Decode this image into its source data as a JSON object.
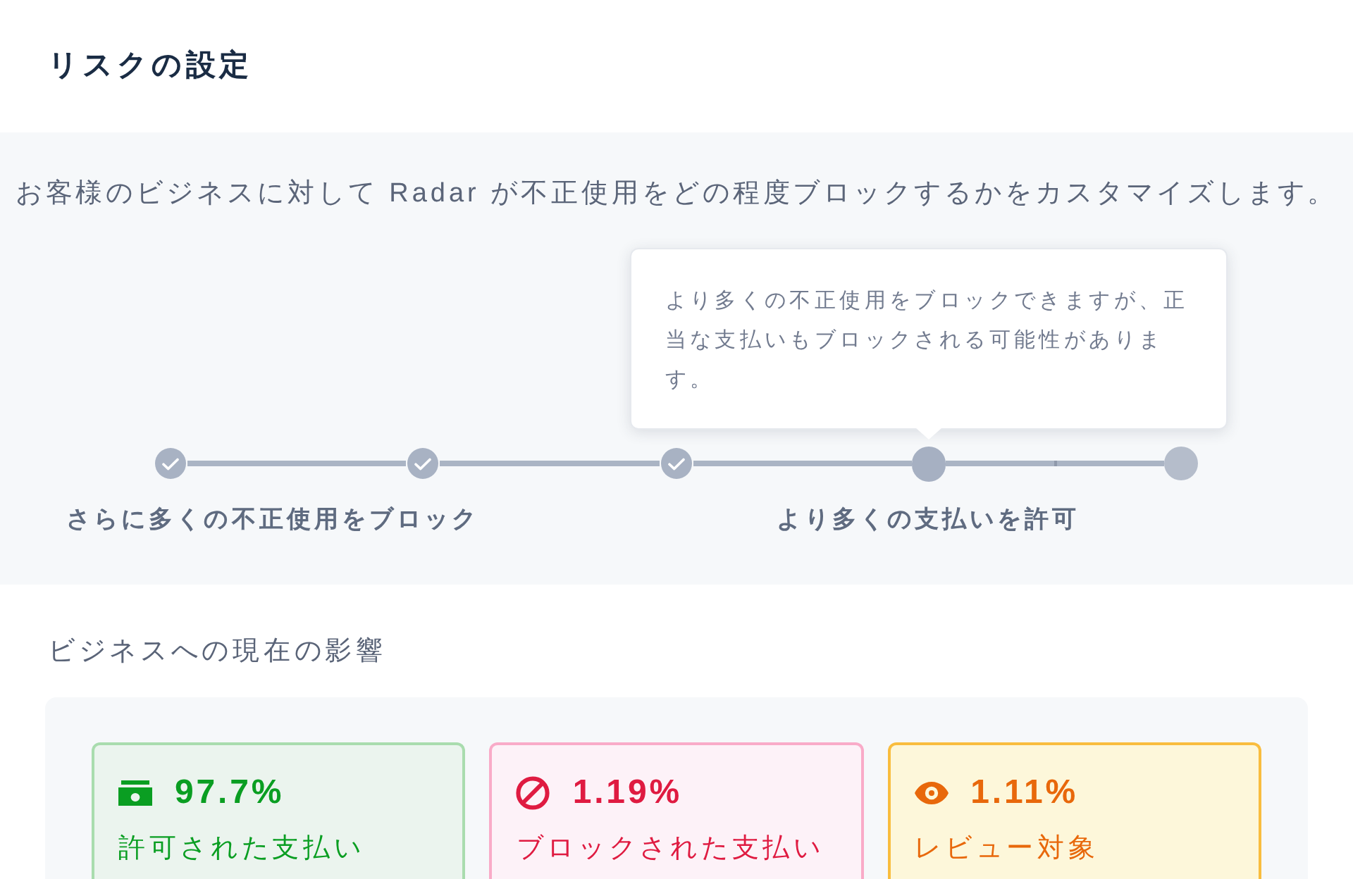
{
  "page": {
    "title": "リスクの設定"
  },
  "risk_settings": {
    "description": "お客様のビジネスに対して Radar が不正使用をどの程度ブロックするかをカスタマイズします。",
    "tooltip": "より多くの不正使用をブロックできますが、正当な支払いもブロックされる可能性があります。",
    "steps": [
      {
        "checked": true,
        "selected": false,
        "label": "さらに多くの不正使用をブロック"
      },
      {
        "checked": true,
        "selected": false
      },
      {
        "checked": true,
        "selected": false
      },
      {
        "checked": false,
        "selected": true,
        "label": "より多くの支払いを許可"
      },
      {
        "checked": false,
        "selected": false
      }
    ]
  },
  "impact": {
    "title": "ビジネスへの現在の影響",
    "cards": [
      {
        "kind": "allowed",
        "value": "97.7%",
        "label": "許可された支払い"
      },
      {
        "kind": "blocked",
        "value": "1.19%",
        "label": "ブロックされた支払い"
      },
      {
        "kind": "review",
        "value": "1.11%",
        "label": "レビュー対象"
      }
    ]
  }
}
